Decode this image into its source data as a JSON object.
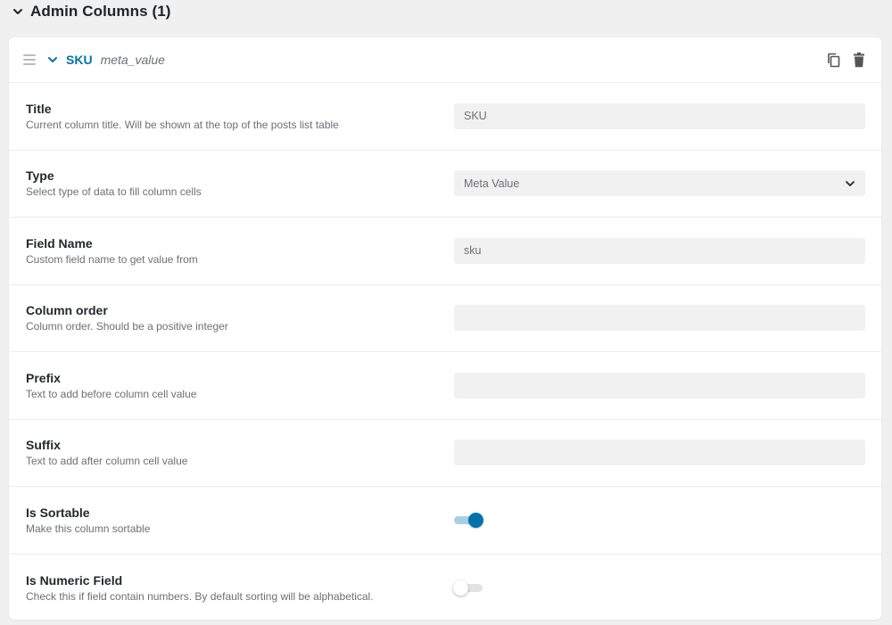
{
  "section": {
    "title": "Admin Columns (1)",
    "chevron_icon": "chevron-down-icon"
  },
  "column": {
    "name": "SKU",
    "meta": "meta_value",
    "icons": {
      "drag": "drag-handle-icon",
      "collapse": "chevron-down-icon",
      "copy": "copy-icon",
      "delete": "trash-icon"
    }
  },
  "fields": {
    "title": {
      "label": "Title",
      "description": "Current column title. Will be shown at the top of the posts list table",
      "value": "SKU"
    },
    "type": {
      "label": "Type",
      "description": "Select type of data to fill column cells",
      "value": "Meta Value"
    },
    "field_name": {
      "label": "Field Name",
      "description": "Custom field name to get value from",
      "value": "sku"
    },
    "column_order": {
      "label": "Column order",
      "description": "Column order. Should be a positive integer",
      "value": ""
    },
    "prefix": {
      "label": "Prefix",
      "description": "Text to add before column cell value",
      "value": ""
    },
    "suffix": {
      "label": "Suffix",
      "description": "Text to add after column cell value",
      "value": ""
    },
    "is_sortable": {
      "label": "Is Sortable",
      "description": "Make this column sortable",
      "checked": true
    },
    "is_numeric": {
      "label": "Is Numeric Field",
      "description": "Check this if field contain numbers. By default sorting will be alphabetical.",
      "checked": false
    }
  },
  "colors": {
    "accent": "#0073aa",
    "accent_light": "#a9cfe6",
    "background": "#f0f0f1",
    "input_bg": "#f1f1f1"
  }
}
